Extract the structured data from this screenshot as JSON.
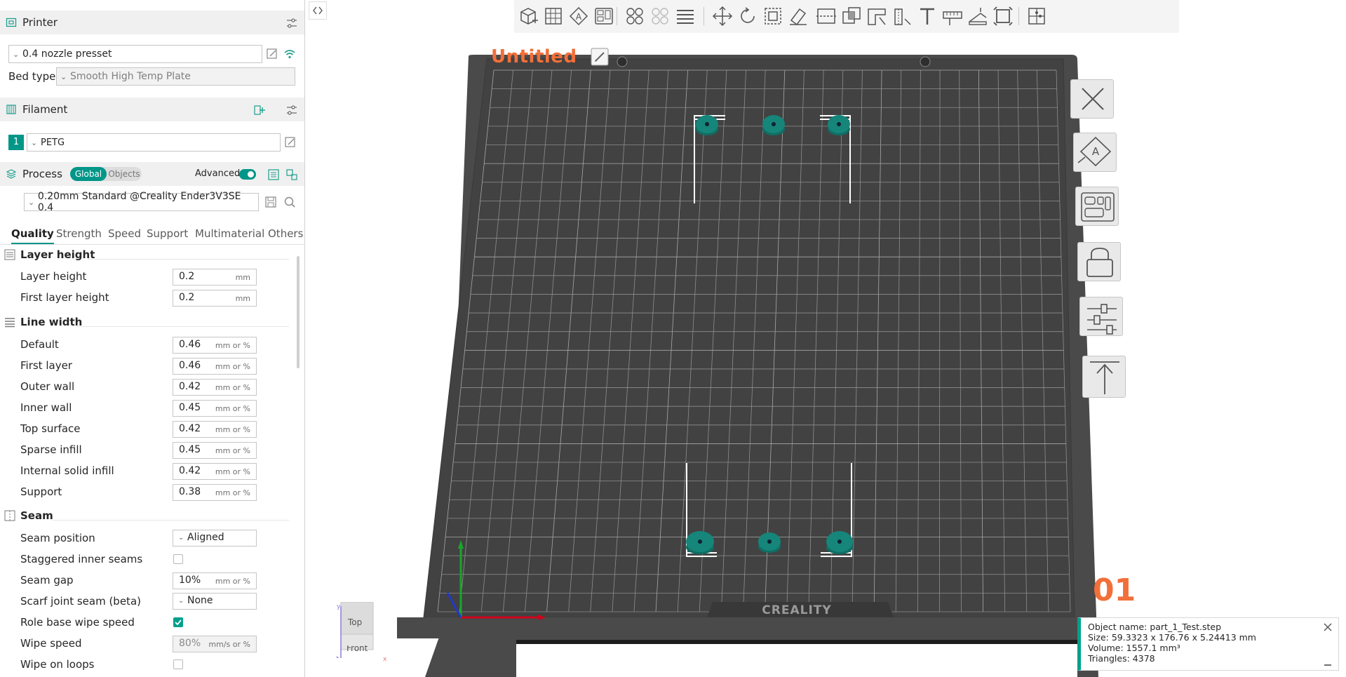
{
  "printer": {
    "title": "Printer",
    "preset": "0.4  nozzle presset",
    "bed_type_label": "Bed type",
    "bed_type": "Smooth High Temp Plate"
  },
  "filament": {
    "title": "Filament",
    "index": "1",
    "name": "PETG",
    "color": "#009688"
  },
  "process": {
    "title": "Process",
    "toggle_global": "Global",
    "toggle_objects": "Objects",
    "advanced_label": "Advanced",
    "preset": "0.20mm Standard @Creality Ender3V3SE 0.4",
    "tabs": [
      "Quality",
      "Strength",
      "Speed",
      "Support",
      "Multimaterial",
      "Others"
    ],
    "active_tab": "Quality"
  },
  "groups": {
    "layer_height": {
      "title": "Layer height",
      "rows": [
        {
          "label": "Layer height",
          "value": "0.2",
          "unit": "mm"
        },
        {
          "label": "First layer height",
          "value": "0.2",
          "unit": "mm"
        }
      ]
    },
    "line_width": {
      "title": "Line width",
      "rows": [
        {
          "label": "Default",
          "value": "0.46",
          "unit": "mm or %"
        },
        {
          "label": "First layer",
          "value": "0.46",
          "unit": "mm or %"
        },
        {
          "label": "Outer wall",
          "value": "0.42",
          "unit": "mm or %"
        },
        {
          "label": "Inner wall",
          "value": "0.45",
          "unit": "mm or %"
        },
        {
          "label": "Top surface",
          "value": "0.42",
          "unit": "mm or %"
        },
        {
          "label": "Sparse infill",
          "value": "0.45",
          "unit": "mm or %"
        },
        {
          "label": "Internal solid infill",
          "value": "0.42",
          "unit": "mm or %"
        },
        {
          "label": "Support",
          "value": "0.38",
          "unit": "mm or %"
        }
      ]
    },
    "seam": {
      "title": "Seam",
      "seam_position_label": "Seam position",
      "seam_position": "Aligned",
      "staggered_label": "Staggered inner seams",
      "staggered_checked": false,
      "seam_gap_label": "Seam gap",
      "seam_gap": "10%",
      "seam_gap_unit": "mm or %",
      "scarf_label": "Scarf joint seam (beta)",
      "scarf": "None",
      "role_wipe_label": "Role base wipe speed",
      "role_wipe_checked": true,
      "wipe_speed_label": "Wipe speed",
      "wipe_speed": "80%",
      "wipe_speed_unit": "mm/s or %",
      "wipe_loops_label": "Wipe on loops",
      "wipe_loops_checked": false
    }
  },
  "viewport": {
    "project_title": "Untitled",
    "plate_number": "01",
    "bed_brand": "CREALITY",
    "view_cube_top": "Top",
    "view_cube_front": "Front",
    "axis_x": "x",
    "axis_y": "y",
    "accent_color": "#f26f3a",
    "toolbar_icons": [
      "add-cube-icon",
      "arrange-grid-icon",
      "auto-orient-icon",
      "plate-layout-icon",
      "split-objects-icon",
      "split-parts-icon",
      "layers-list-icon",
      "move-icon",
      "rotate-icon",
      "scale-icon",
      "paint-eraser-icon",
      "cut-icon",
      "boolean-icon",
      "support-paint-icon",
      "seam-paint-icon",
      "text-icon",
      "measure-icon",
      "assembly-icon",
      "fit-view-icon",
      "puzzle-icon"
    ],
    "side_tools": [
      "delete-plate-icon",
      "auto-orient-plate-icon",
      "arrange-plate-icon",
      "lock-plate-icon",
      "plate-settings-icon",
      "move-to-top-icon"
    ]
  },
  "object_info": {
    "name": "Object name: part_1_Test.step",
    "size": "Size: 59.3323 x 176.76 x 5.24413 mm",
    "volume": "Volume: 1557.1 mm³",
    "triangles": "Triangles: 4378"
  }
}
